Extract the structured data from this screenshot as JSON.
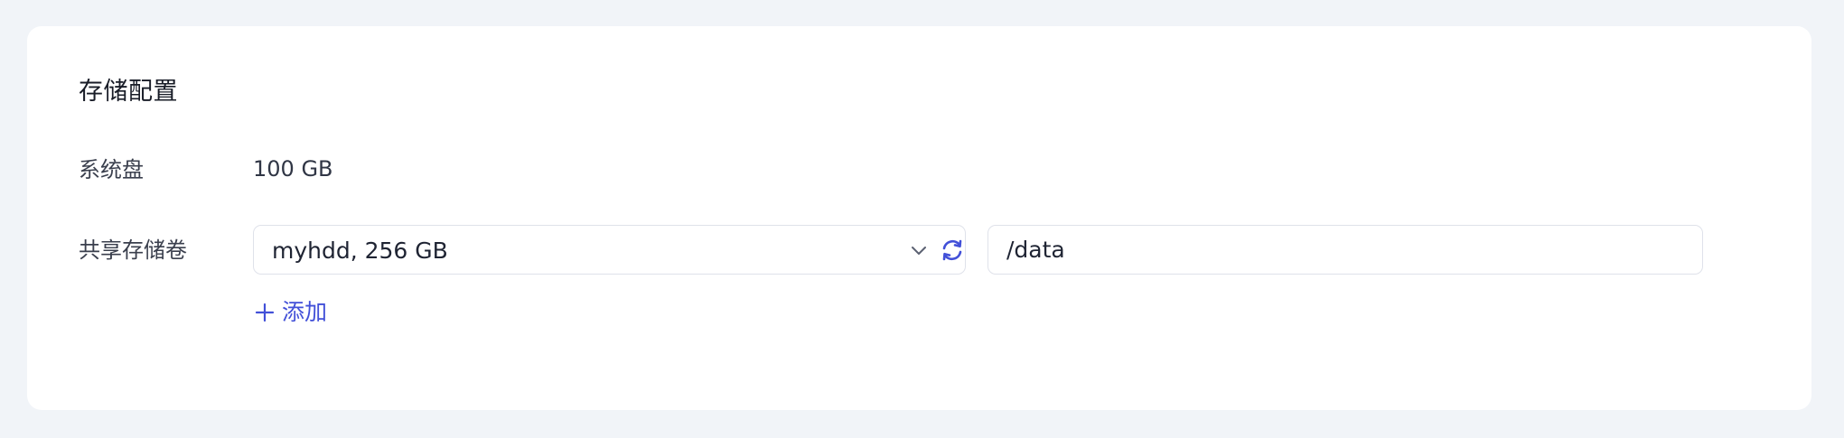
{
  "section": {
    "title": "存储配置"
  },
  "system_disk": {
    "label": "系统盘",
    "value": "100 GB"
  },
  "shared_volume": {
    "label": "共享存储卷",
    "selected": "myhdd, 256 GB",
    "mount_path": "/data",
    "add_label": "添加"
  },
  "icons": {
    "dropdown": "chevron-down-icon",
    "refresh": "refresh-icon",
    "add": "plus-icon"
  },
  "colors": {
    "page_bg": "#f1f4f8",
    "card_bg": "#ffffff",
    "accent": "#4250d8",
    "border": "#dfe2ea"
  }
}
